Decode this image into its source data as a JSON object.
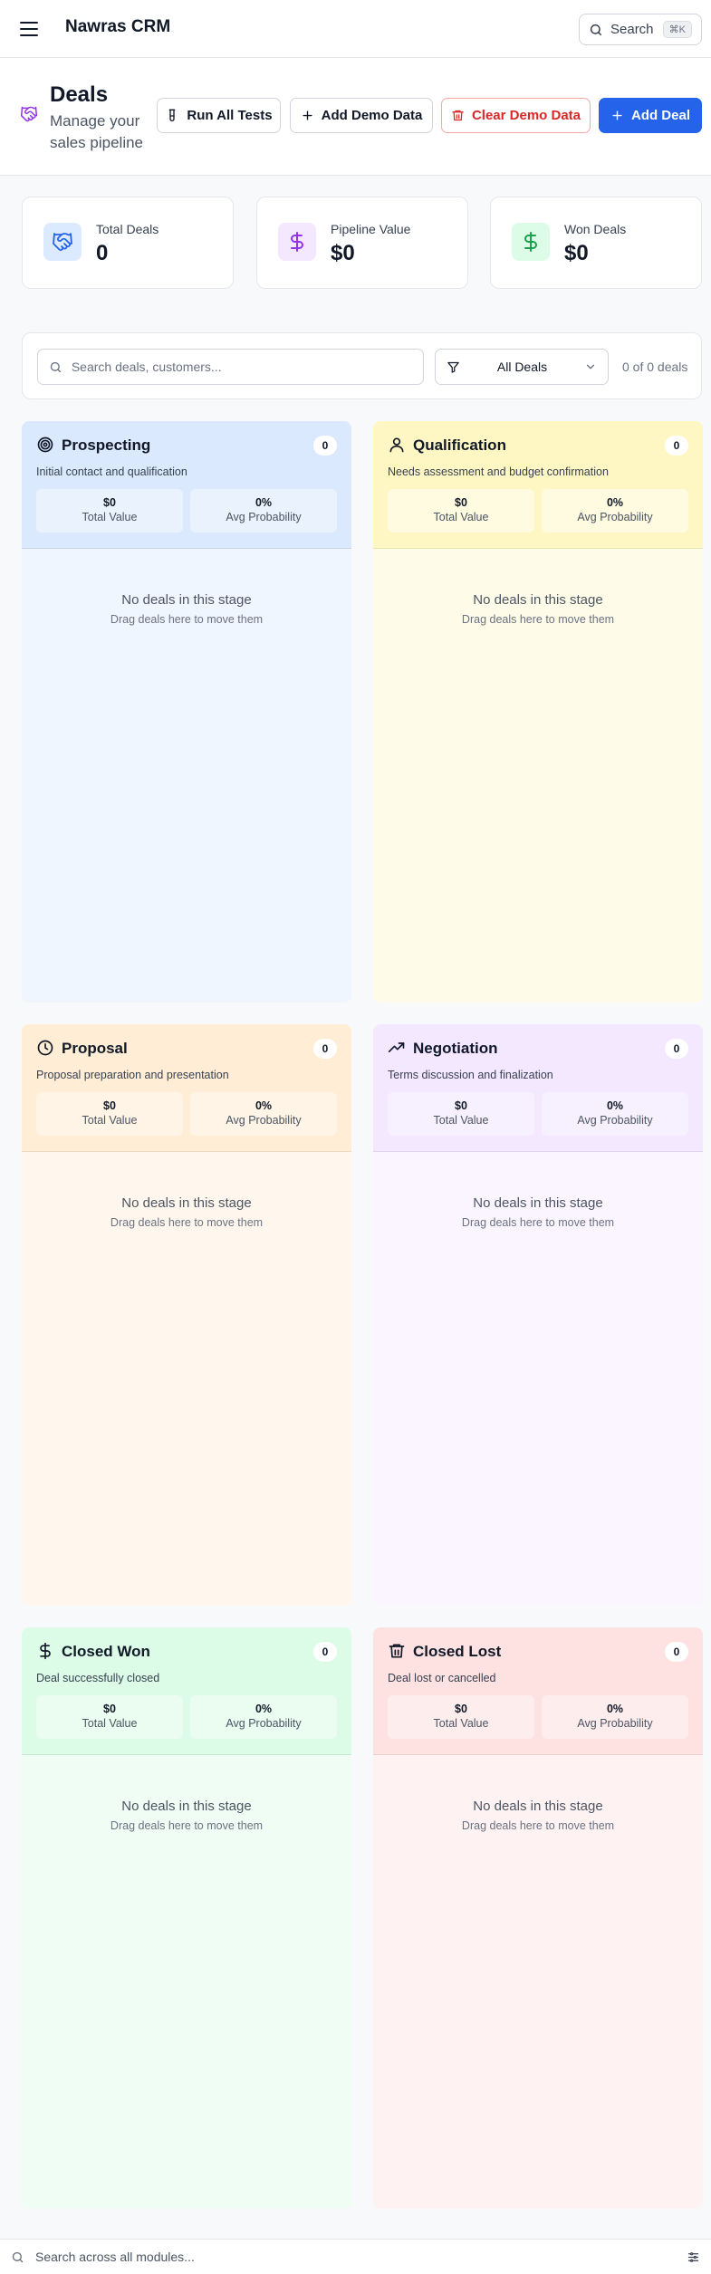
{
  "app": {
    "title": "Nawras CRM"
  },
  "topbar": {
    "search_label": "Search",
    "search_shortcut": "⌘K"
  },
  "header": {
    "title": "Deals",
    "subtitle": "Manage your sales pipeline",
    "buttons": {
      "run_tests": "Run All Tests",
      "add_demo": "Add Demo Data",
      "clear_demo": "Clear Demo Data",
      "add_deal": "Add Deal"
    }
  },
  "stats": [
    {
      "label": "Total Deals",
      "value": "0",
      "icon": "handshake-icon",
      "color": "#2563eb",
      "bg": "#dbeafe"
    },
    {
      "label": "Pipeline Value",
      "value": "$0",
      "icon": "dollar-icon",
      "color": "#9333ea",
      "bg": "#f3e8ff"
    },
    {
      "label": "Won Deals",
      "value": "$0",
      "icon": "dollar-icon",
      "color": "#16a34a",
      "bg": "#dcfce7"
    }
  ],
  "filters": {
    "search_placeholder": "Search deals, customers...",
    "filter_value": "All Deals",
    "count_text": "0 of 0 deals"
  },
  "stages": [
    {
      "name": "Prospecting",
      "count": "0",
      "description": "Initial contact and qualification",
      "total_value": "$0",
      "total_value_label": "Total Value",
      "avg_prob": "0%",
      "avg_prob_label": "Avg Probability",
      "empty_title": "No deals in this stage",
      "empty_hint": "Drag deals here to move them",
      "icon": "target-icon",
      "head_bg": "#dbe9fe",
      "body_bg": "#eff6ff",
      "metric_bg": "#eaf2fe"
    },
    {
      "name": "Qualification",
      "count": "0",
      "description": "Needs assessment and budget confirmation",
      "total_value": "$0",
      "total_value_label": "Total Value",
      "avg_prob": "0%",
      "avg_prob_label": "Avg Probability",
      "empty_title": "No deals in this stage",
      "empty_hint": "Drag deals here to move them",
      "icon": "user-icon",
      "head_bg": "#fef7c3",
      "body_bg": "#fefce8",
      "metric_bg": "#fefbe1"
    },
    {
      "name": "Proposal",
      "count": "0",
      "description": "Proposal preparation and presentation",
      "total_value": "$0",
      "total_value_label": "Total Value",
      "avg_prob": "0%",
      "avg_prob_label": "Avg Probability",
      "empty_title": "No deals in this stage",
      "empty_hint": "Drag deals here to move them",
      "icon": "clock-icon",
      "head_bg": "#ffedd5",
      "body_bg": "#fff7ed",
      "metric_bg": "#fff4e6"
    },
    {
      "name": "Negotiation",
      "count": "0",
      "description": "Terms discussion and finalization",
      "total_value": "$0",
      "total_value_label": "Total Value",
      "avg_prob": "0%",
      "avg_prob_label": "Avg Probability",
      "empty_title": "No deals in this stage",
      "empty_hint": "Drag deals here to move them",
      "icon": "trending-up-icon",
      "head_bg": "#f3e8ff",
      "body_bg": "#faf5ff",
      "metric_bg": "#f7f0ff"
    },
    {
      "name": "Closed Won",
      "count": "0",
      "description": "Deal successfully closed",
      "total_value": "$0",
      "total_value_label": "Total Value",
      "avg_prob": "0%",
      "avg_prob_label": "Avg Probability",
      "empty_title": "No deals in this stage",
      "empty_hint": "Drag deals here to move them",
      "icon": "dollar-icon",
      "head_bg": "#dcfce7",
      "body_bg": "#f0fdf4",
      "metric_bg": "#ebfcf0"
    },
    {
      "name": "Closed Lost",
      "count": "0",
      "description": "Deal lost or cancelled",
      "total_value": "$0",
      "total_value_label": "Total Value",
      "avg_prob": "0%",
      "avg_prob_label": "Avg Probability",
      "empty_title": "No deals in this stage",
      "empty_hint": "Drag deals here to move them",
      "icon": "trash-icon",
      "head_bg": "#fee2e2",
      "body_bg": "#fef2f2",
      "metric_bg": "#feeded"
    }
  ],
  "bottom": {
    "search_placeholder": "Search across all modules..."
  }
}
